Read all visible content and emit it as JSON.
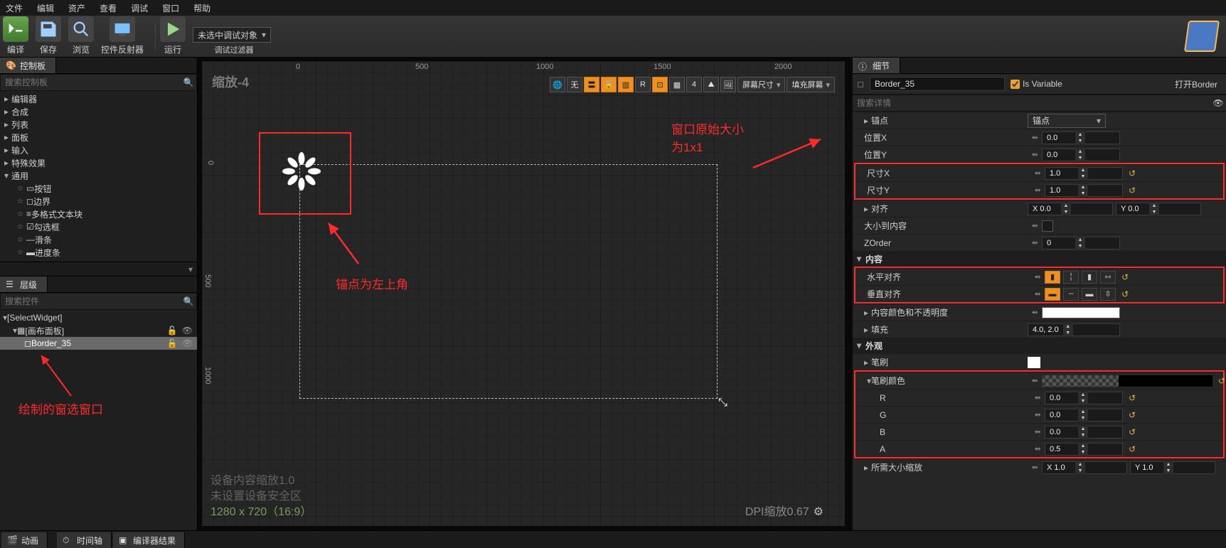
{
  "menu": [
    "文件",
    "编辑",
    "资产",
    "查看",
    "调试",
    "窗口",
    "帮助"
  ],
  "toolbar": {
    "compile": "编译",
    "save": "保存",
    "browse": "浏览",
    "reflector": "控件反射器",
    "run": "运行",
    "debug_target": "未选中调试对象",
    "debug_filter": "调试过滤器"
  },
  "palette_tab": "控制板",
  "palette_search_ph": "搜索控制板",
  "palette_cats": {
    "editor": "编辑器",
    "compose": "合成",
    "list": "列表",
    "panel": "面板",
    "input": "输入",
    "fx": "特殊效果",
    "common": "通用"
  },
  "palette_items": {
    "button": "按钮",
    "border": "边界",
    "richtext": "多格式文本块",
    "checkbox": "勾选框",
    "slider": "滑条",
    "progress": "进度条"
  },
  "hierarchy_tab": "层级",
  "hierarchy_search_ph": "搜索控件",
  "hierarchy": {
    "root": "[SelectWidget]",
    "canvas": "[画布面板]",
    "border": "Border_35"
  },
  "redtext_hier": "绘制的窗选窗口",
  "viewport": {
    "zoom_label": "缩放-4",
    "ticks": [
      "0",
      "500",
      "1000",
      "1500",
      "2000"
    ],
    "vticks": [
      "0",
      "500",
      "1000"
    ],
    "btn_R": "R",
    "screensize": "屏幕尺寸",
    "fillscreen": "填充屏幕",
    "red_anchor": "锚点为左上角",
    "red_size": "窗口原始大小\n为1x1",
    "footer1": "设备内容缩放1.0",
    "footer2": "未设置设备安全区",
    "footer3": "1280 x 720（16:9）",
    "dpi": "DPI缩放0.67"
  },
  "details_tab": "细节",
  "details": {
    "name": "Border_35",
    "is_variable": "Is Variable",
    "open_border": "打开Border",
    "search_ph": "搜索详情",
    "cat_anchor": "锚点",
    "anchor_combo": "锚点",
    "posx": "位置X",
    "posx_v": "0.0",
    "posy": "位置Y",
    "posy_v": "0.0",
    "sizex": "尺寸X",
    "sizex_v": "1.0",
    "sizey": "尺寸Y",
    "sizey_v": "1.0",
    "align": "对齐",
    "align_x": "X 0.0",
    "align_y": "Y 0.0",
    "sizetocontent": "大小到内容",
    "zorder": "ZOrder",
    "zorder_v": "0",
    "cat_content": "内容",
    "halign": "水平对齐",
    "valign": "垂直对齐",
    "colopacity": "内容颜色和不透明度",
    "padding": "填充",
    "padding_v": "4.0, 2.0",
    "cat_appear": "外观",
    "brush": "笔刷",
    "brushcolor": "笔刷颜色",
    "r": "R",
    "r_v": "0.0",
    "g": "G",
    "g_v": "0.0",
    "b": "B",
    "b_v": "0.0",
    "a": "A",
    "a_v": "0.5",
    "drawscale": "所需大小缩放",
    "drawscale_x": "X 1.0",
    "drawscale_y": "Y 1.0"
  },
  "bottom_tabs": {
    "anim": "动画",
    "timeline": "时间轴",
    "compiler": "编译器结果"
  }
}
